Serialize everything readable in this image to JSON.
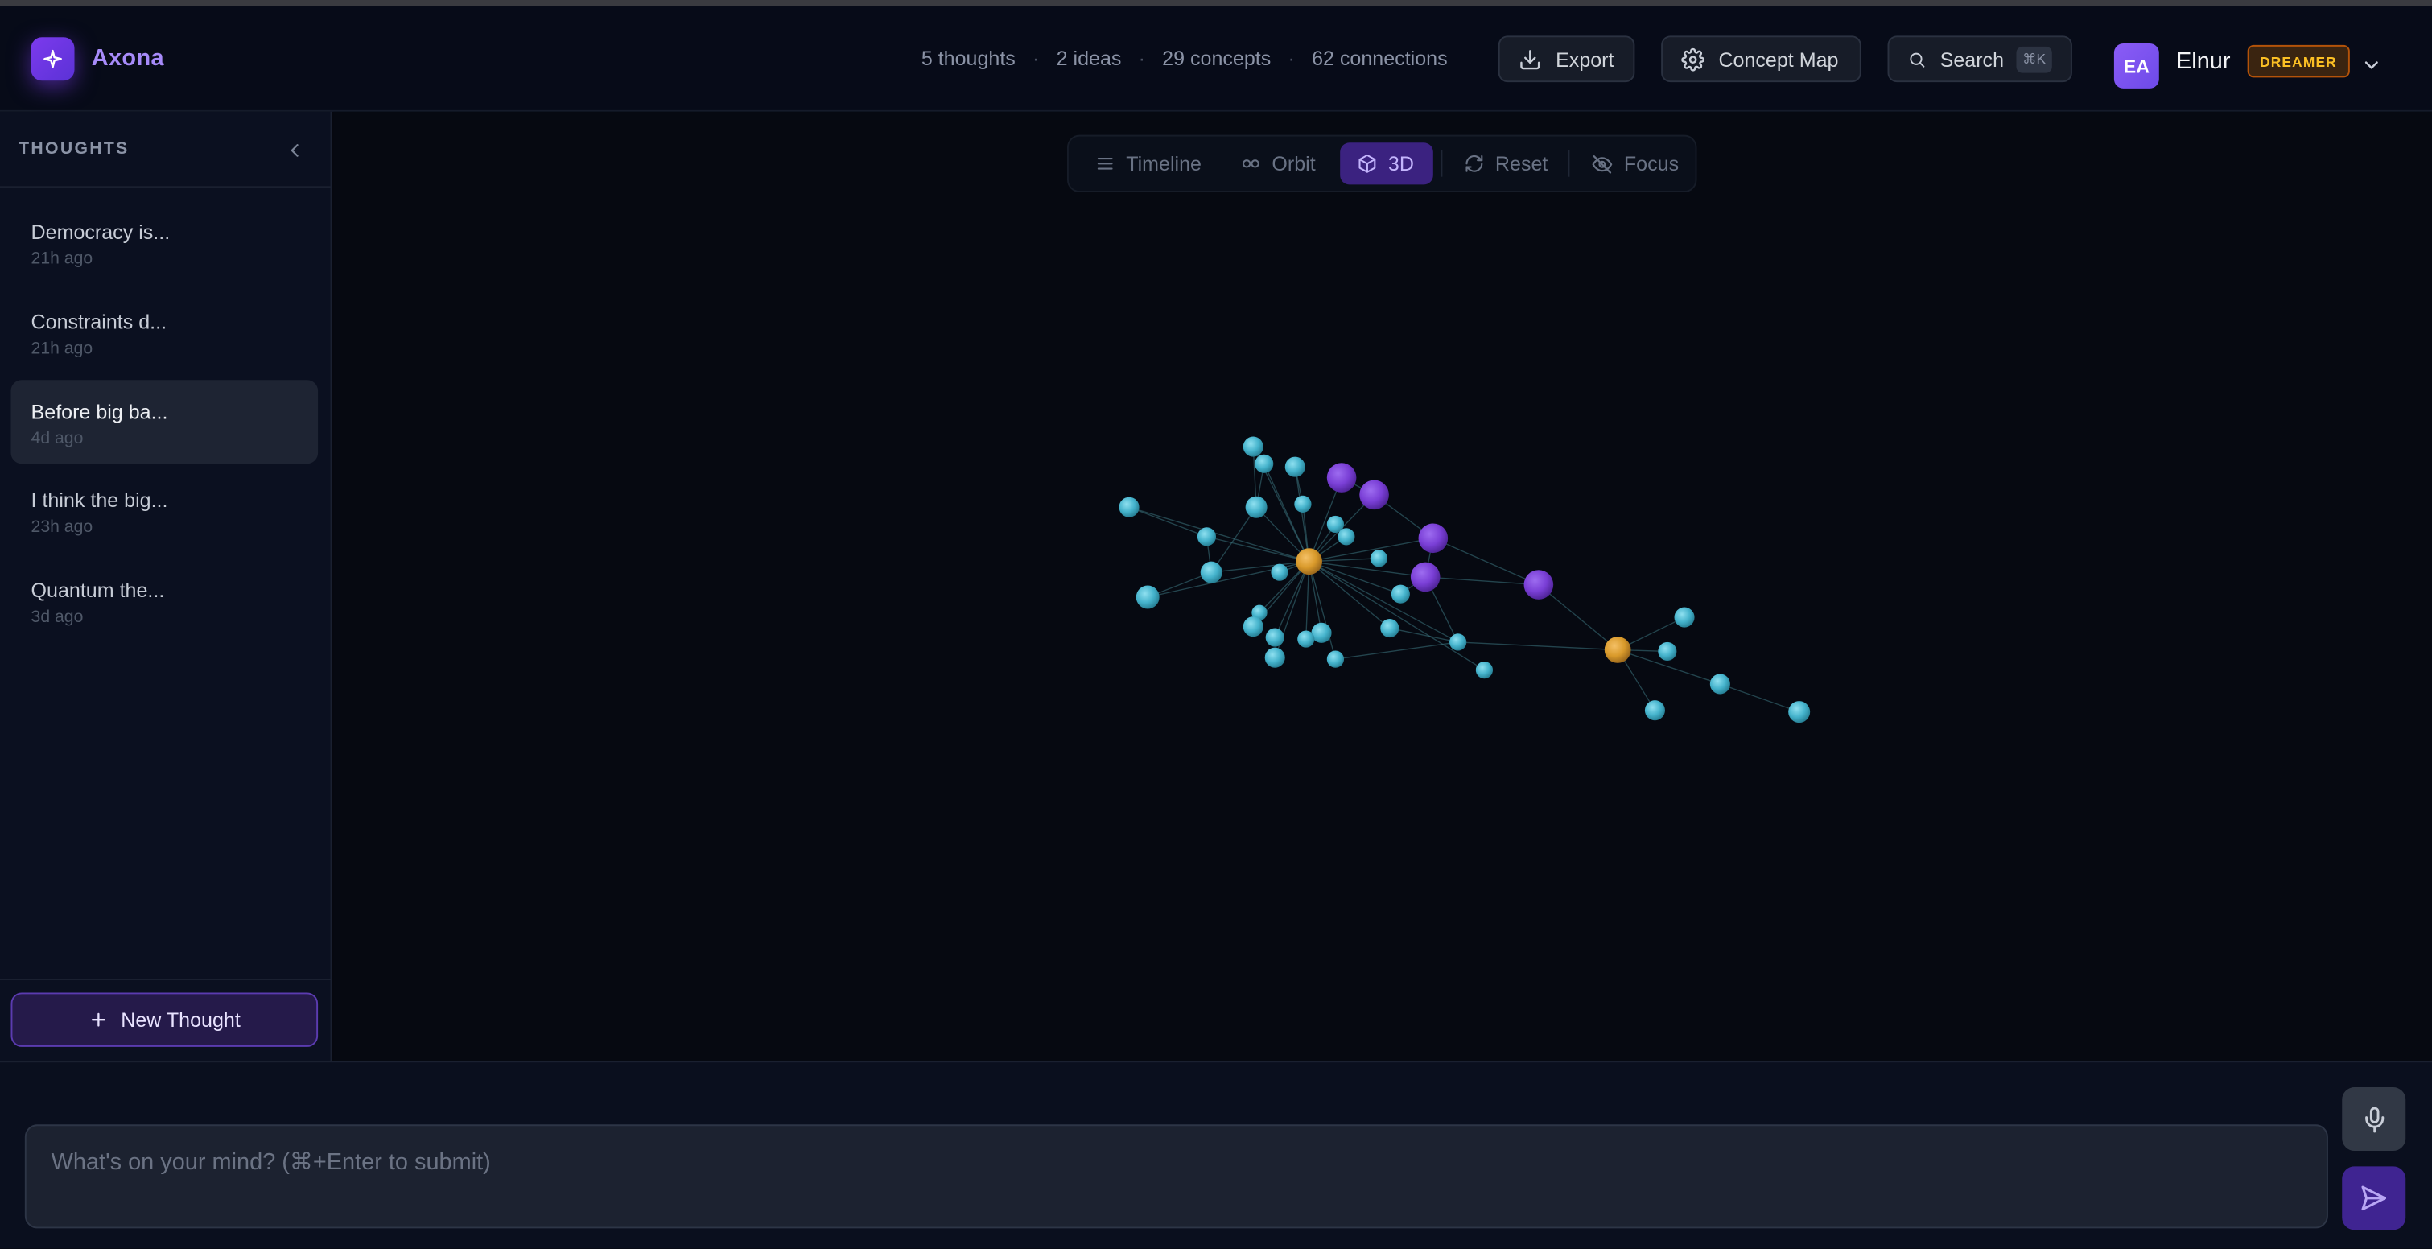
{
  "app": {
    "name": "Axona",
    "logo_icon": "sparkle-icon",
    "brand_color": "#7c3aed"
  },
  "header": {
    "stats": {
      "thoughts": "5 thoughts",
      "ideas": "2 ideas",
      "concepts": "29 concepts",
      "connections": "62 connections",
      "separator": "·"
    },
    "export_label": "Export",
    "concept_map_label": "Concept Map",
    "search_label": "Search",
    "search_shortcut": "⌘K",
    "user": {
      "initials": "EA",
      "name": "Elnur",
      "tier": "DREAMER"
    }
  },
  "sidebar": {
    "title": "THOUGHTS",
    "items": [
      {
        "title": "Democracy is...",
        "time": "21h ago",
        "active": false
      },
      {
        "title": "Constraints d...",
        "time": "21h ago",
        "active": false
      },
      {
        "title": "Before big ba...",
        "time": "4d ago",
        "active": true
      },
      {
        "title": "I think the big...",
        "time": "23h ago",
        "active": false
      },
      {
        "title": "Quantum the...",
        "time": "3d ago",
        "active": false
      }
    ],
    "new_thought_label": "New Thought"
  },
  "view_toolbar": {
    "timeline": "Timeline",
    "orbit": "Orbit",
    "three_d": "3D",
    "reset": "Reset",
    "focus": "Focus",
    "active_view": "3D"
  },
  "graph_colors": {
    "concept": "#45b3cc",
    "idea": "#7a3fd6",
    "thought": "#d99a2b",
    "link": "#3d7480"
  },
  "composer": {
    "placeholder": "What's on your mind? (⌘+Enter to submit)",
    "value": "",
    "mic_icon": "microphone-icon",
    "send_icon": "send-icon"
  }
}
